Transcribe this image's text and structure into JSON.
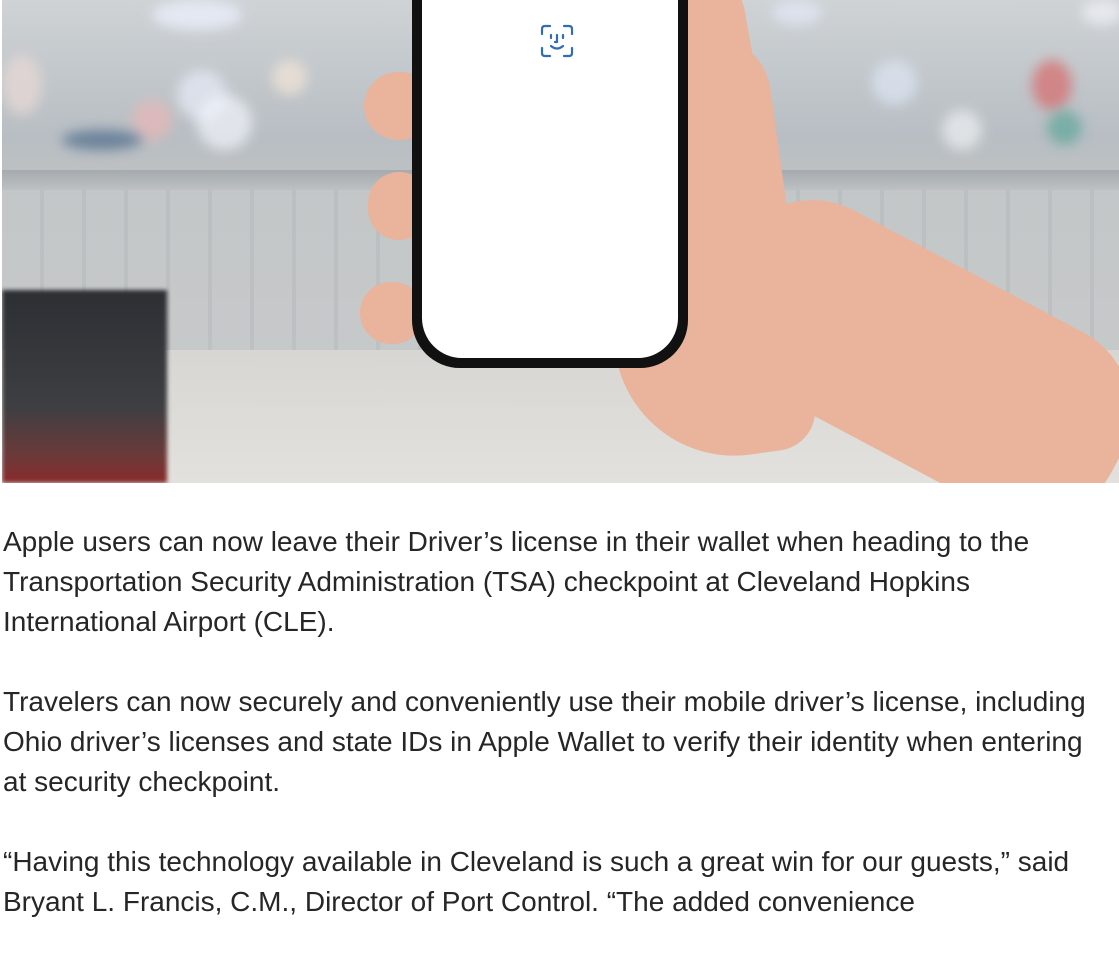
{
  "hero_image": {
    "icon": "face-id-icon",
    "accent_color": "#2f6db5"
  },
  "article": {
    "paragraphs": [
      "Apple users can now leave their Driver’s license in their wallet when heading to the Transportation Security Administration (TSA) checkpoint at Cleveland Hopkins International Airport (CLE).",
      "Travelers can now securely and conveniently use their mobile driver’s license, including Ohio driver’s licenses and state IDs in Apple Wallet to verify their identity when entering at security checkpoint.",
      " “Having this technology available in Cleveland is such a great win for our guests,” said Bryant L. Francis, C.M., Director of Port Control. “The added convenience"
    ]
  }
}
